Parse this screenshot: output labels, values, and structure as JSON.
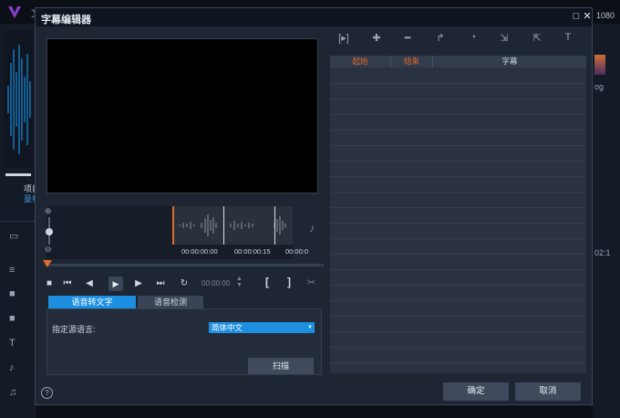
{
  "background_app": {
    "title": "文",
    "resolution": "1080",
    "media_label_1": "项目",
    "media_label_2": "量标",
    "right_panel_text_1": "og",
    "right_panel_text_2": "02:1"
  },
  "dialog": {
    "title": "字幕编辑器",
    "close_glyph": "✕",
    "maximize_glyph": "□",
    "audio": {
      "timecodes": [
        "00:00:00:00",
        "00:00:00:15",
        "00:00:0"
      ]
    },
    "playback": {
      "timecode": "00:00:00"
    },
    "tabs": [
      {
        "label": "语音转文字",
        "active": true
      },
      {
        "label": "语音检测",
        "active": false
      }
    ],
    "speech_to_text": {
      "source_language_label": "指定源语言:",
      "source_language_value": "简体中文",
      "scan_label": "扫描"
    },
    "table": {
      "columns": [
        "起始",
        "结束",
        "字幕"
      ]
    },
    "footer": {
      "help_glyph": "?",
      "ok_label": "确定",
      "cancel_label": "取消"
    }
  },
  "colors": {
    "accent": "#1d8fe0",
    "marker": "#e06a2a",
    "dialog_bg": "#1e2533"
  }
}
